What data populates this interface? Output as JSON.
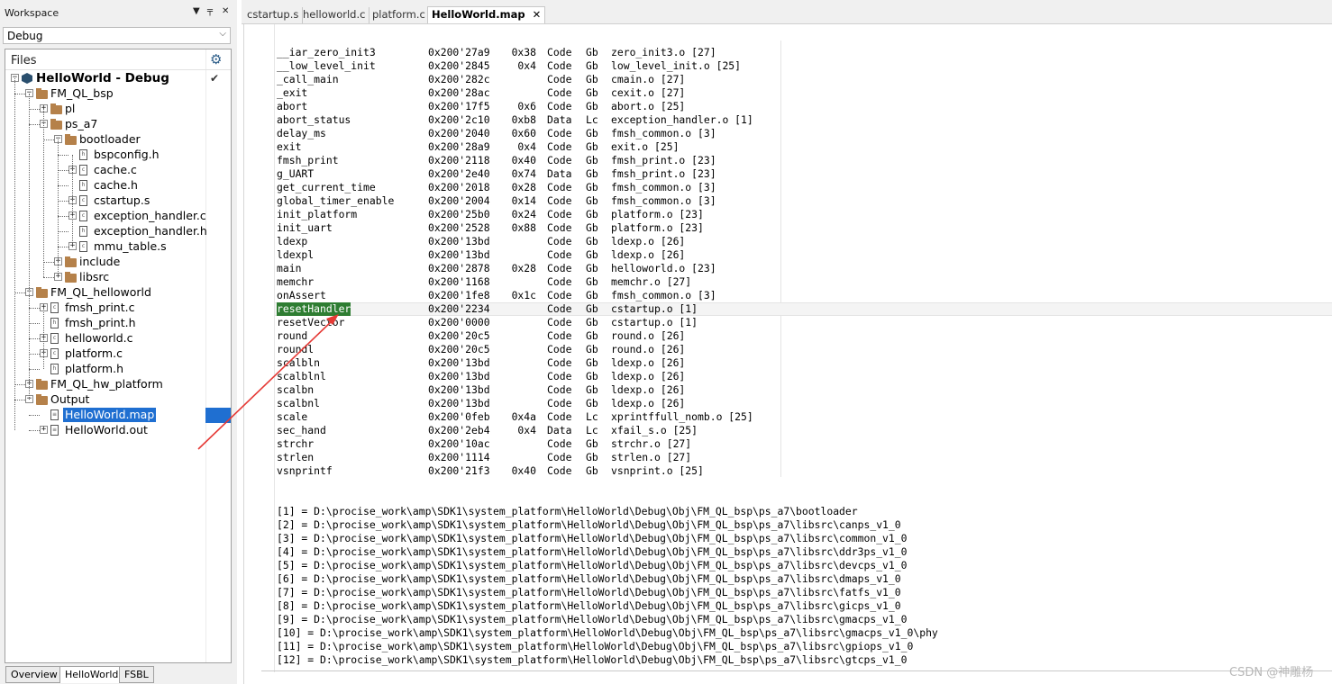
{
  "workspace": {
    "title": "Workspace",
    "config": "Debug",
    "files_label": "Files",
    "project_name": "HelloWorld - Debug",
    "tree": [
      {
        "label": "HelloWorld - Debug",
        "kind": "project",
        "depth": 0,
        "exp": "-",
        "check": true,
        "bold": true
      },
      {
        "label": "FM_QL_bsp",
        "kind": "folder",
        "depth": 1,
        "exp": "-"
      },
      {
        "label": "pl",
        "kind": "folder",
        "depth": 2,
        "exp": "+"
      },
      {
        "label": "ps_a7",
        "kind": "folder",
        "depth": 2,
        "exp": "-"
      },
      {
        "label": "bootloader",
        "kind": "folder",
        "depth": 3,
        "exp": "-"
      },
      {
        "label": "bspconfig.h",
        "kind": "file",
        "depth": 4,
        "exp": ""
      },
      {
        "label": "cache.c",
        "kind": "file",
        "depth": 4,
        "exp": "+"
      },
      {
        "label": "cache.h",
        "kind": "file",
        "depth": 4,
        "exp": ""
      },
      {
        "label": "cstartup.s",
        "kind": "file",
        "depth": 4,
        "exp": "+"
      },
      {
        "label": "exception_handler.c",
        "kind": "file",
        "depth": 4,
        "exp": "+"
      },
      {
        "label": "exception_handler.h",
        "kind": "file",
        "depth": 4,
        "exp": ""
      },
      {
        "label": "mmu_table.s",
        "kind": "file",
        "depth": 4,
        "exp": "+"
      },
      {
        "label": "include",
        "kind": "folder",
        "depth": 3,
        "exp": "+"
      },
      {
        "label": "libsrc",
        "kind": "folder",
        "depth": 3,
        "exp": "+"
      },
      {
        "label": "FM_QL_helloworld",
        "kind": "folder",
        "depth": 1,
        "exp": "-"
      },
      {
        "label": "fmsh_print.c",
        "kind": "file",
        "depth": 2,
        "exp": "+"
      },
      {
        "label": "fmsh_print.h",
        "kind": "file",
        "depth": 2,
        "exp": ""
      },
      {
        "label": "helloworld.c",
        "kind": "file",
        "depth": 2,
        "exp": "+"
      },
      {
        "label": "platform.c",
        "kind": "file",
        "depth": 2,
        "exp": "+"
      },
      {
        "label": "platform.h",
        "kind": "file",
        "depth": 2,
        "exp": ""
      },
      {
        "label": "FM_QL_hw_platform",
        "kind": "folder",
        "depth": 1,
        "exp": "+"
      },
      {
        "label": "Output",
        "kind": "folder",
        "depth": 1,
        "exp": "-"
      },
      {
        "label": "HelloWorld.map",
        "kind": "doc",
        "depth": 2,
        "exp": "",
        "selected": true
      },
      {
        "label": "HelloWorld.out",
        "kind": "doc",
        "depth": 2,
        "exp": "+"
      }
    ],
    "bottom_tabs": [
      "Overview",
      "HelloWorld",
      "FSBL"
    ]
  },
  "editor": {
    "tabs": [
      "cstartup.s",
      "helloworld.c",
      "platform.c",
      "HelloWorld.map"
    ],
    "active_tab": "HelloWorld.map",
    "close_glyph": "✕",
    "symbols": [
      [
        "__iar_zero_init3",
        "0x200'27a9",
        "0x38",
        "Code",
        "Gb",
        "zero_init3.o [27]"
      ],
      [
        "__low_level_init",
        "0x200'2845",
        "0x4",
        "Code",
        "Gb",
        "low_level_init.o [25]"
      ],
      [
        "_call_main",
        "0x200'282c",
        "",
        "Code",
        "Gb",
        "cmain.o [27]"
      ],
      [
        "_exit",
        "0x200'28ac",
        "",
        "Code",
        "Gb",
        "cexit.o [27]"
      ],
      [
        "abort",
        "0x200'17f5",
        "0x6",
        "Code",
        "Gb",
        "abort.o [25]"
      ],
      [
        "abort_status",
        "0x200'2c10",
        "0xb8",
        "Data",
        "Lc",
        "exception_handler.o [1]"
      ],
      [
        "delay_ms",
        "0x200'2040",
        "0x60",
        "Code",
        "Gb",
        "fmsh_common.o [3]"
      ],
      [
        "exit",
        "0x200'28a9",
        "0x4",
        "Code",
        "Gb",
        "exit.o [25]"
      ],
      [
        "fmsh_print",
        "0x200'2118",
        "0x40",
        "Code",
        "Gb",
        "fmsh_print.o [23]"
      ],
      [
        "g_UART",
        "0x200'2e40",
        "0x74",
        "Data",
        "Gb",
        "fmsh_print.o [23]"
      ],
      [
        "get_current_time",
        "0x200'2018",
        "0x28",
        "Code",
        "Gb",
        "fmsh_common.o [3]"
      ],
      [
        "global_timer_enable",
        "0x200'2004",
        "0x14",
        "Code",
        "Gb",
        "fmsh_common.o [3]"
      ],
      [
        "init_platform",
        "0x200'25b0",
        "0x24",
        "Code",
        "Gb",
        "platform.o [23]"
      ],
      [
        "init_uart",
        "0x200'2528",
        "0x88",
        "Code",
        "Gb",
        "platform.o [23]"
      ],
      [
        "ldexp",
        "0x200'13bd",
        "",
        "Code",
        "Gb",
        "ldexp.o [26]"
      ],
      [
        "ldexpl",
        "0x200'13bd",
        "",
        "Code",
        "Gb",
        "ldexp.o [26]"
      ],
      [
        "main",
        "0x200'2878",
        "0x28",
        "Code",
        "Gb",
        "helloworld.o [23]"
      ],
      [
        "memchr",
        "0x200'1168",
        "",
        "Code",
        "Gb",
        "memchr.o [27]"
      ],
      [
        "onAssert",
        "0x200'1fe8",
        "0x1c",
        "Code",
        "Gb",
        "fmsh_common.o [3]"
      ],
      [
        "resetHandler",
        "0x200'2234",
        "",
        "Code",
        "Gb",
        "cstartup.o [1]"
      ],
      [
        "resetVector",
        "0x200'0000",
        "",
        "Code",
        "Gb",
        "cstartup.o [1]"
      ],
      [
        "round",
        "0x200'20c5",
        "",
        "Code",
        "Gb",
        "round.o [26]"
      ],
      [
        "roundl",
        "0x200'20c5",
        "",
        "Code",
        "Gb",
        "round.o [26]"
      ],
      [
        "scalbln",
        "0x200'13bd",
        "",
        "Code",
        "Gb",
        "ldexp.o [26]"
      ],
      [
        "scalblnl",
        "0x200'13bd",
        "",
        "Code",
        "Gb",
        "ldexp.o [26]"
      ],
      [
        "scalbn",
        "0x200'13bd",
        "",
        "Code",
        "Gb",
        "ldexp.o [26]"
      ],
      [
        "scalbnl",
        "0x200'13bd",
        "",
        "Code",
        "Gb",
        "ldexp.o [26]"
      ],
      [
        "scale",
        "0x200'0feb",
        "0x4a",
        "Code",
        "Lc",
        "xprintffull_nomb.o [25]"
      ],
      [
        "sec_hand",
        "0x200'2eb4",
        "0x4",
        "Data",
        "Lc",
        "xfail_s.o [25]"
      ],
      [
        "strchr",
        "0x200'10ac",
        "",
        "Code",
        "Gb",
        "strchr.o [27]"
      ],
      [
        "strlen",
        "0x200'1114",
        "",
        "Code",
        "Gb",
        "strlen.o [27]"
      ],
      [
        "vsnprintf",
        "0x200'21f3",
        "0x40",
        "Code",
        "Gb",
        "vsnprint.o [25]"
      ]
    ],
    "highlighted_symbol": "resetHandler",
    "paths": [
      "[1] = D:\\procise_work\\amp\\SDK1\\system_platform\\HelloWorld\\Debug\\Obj\\FM_QL_bsp\\ps_a7\\bootloader",
      "[2] = D:\\procise_work\\amp\\SDK1\\system_platform\\HelloWorld\\Debug\\Obj\\FM_QL_bsp\\ps_a7\\libsrc\\canps_v1_0",
      "[3] = D:\\procise_work\\amp\\SDK1\\system_platform\\HelloWorld\\Debug\\Obj\\FM_QL_bsp\\ps_a7\\libsrc\\common_v1_0",
      "[4] = D:\\procise_work\\amp\\SDK1\\system_platform\\HelloWorld\\Debug\\Obj\\FM_QL_bsp\\ps_a7\\libsrc\\ddr3ps_v1_0",
      "[5] = D:\\procise_work\\amp\\SDK1\\system_platform\\HelloWorld\\Debug\\Obj\\FM_QL_bsp\\ps_a7\\libsrc\\devcps_v1_0",
      "[6] = D:\\procise_work\\amp\\SDK1\\system_platform\\HelloWorld\\Debug\\Obj\\FM_QL_bsp\\ps_a7\\libsrc\\dmaps_v1_0",
      "[7] = D:\\procise_work\\amp\\SDK1\\system_platform\\HelloWorld\\Debug\\Obj\\FM_QL_bsp\\ps_a7\\libsrc\\fatfs_v1_0",
      "[8] = D:\\procise_work\\amp\\SDK1\\system_platform\\HelloWorld\\Debug\\Obj\\FM_QL_bsp\\ps_a7\\libsrc\\gicps_v1_0",
      "[9] = D:\\procise_work\\amp\\SDK1\\system_platform\\HelloWorld\\Debug\\Obj\\FM_QL_bsp\\ps_a7\\libsrc\\gmacps_v1_0",
      "[10] = D:\\procise_work\\amp\\SDK1\\system_platform\\HelloWorld\\Debug\\Obj\\FM_QL_bsp\\ps_a7\\libsrc\\gmacps_v1_0\\phy",
      "[11] = D:\\procise_work\\amp\\SDK1\\system_platform\\HelloWorld\\Debug\\Obj\\FM_QL_bsp\\ps_a7\\libsrc\\gpiops_v1_0",
      "[12] = D:\\procise_work\\amp\\SDK1\\system_platform\\HelloWorld\\Debug\\Obj\\FM_QL_bsp\\ps_a7\\libsrc\\gtcps_v1_0"
    ]
  },
  "watermark": "CSDN @神雕杨",
  "colors": {
    "selection": "#1f6fd1",
    "highlight": "#2e7d32",
    "arrow": "#e53935",
    "folder": "#b5814a"
  }
}
